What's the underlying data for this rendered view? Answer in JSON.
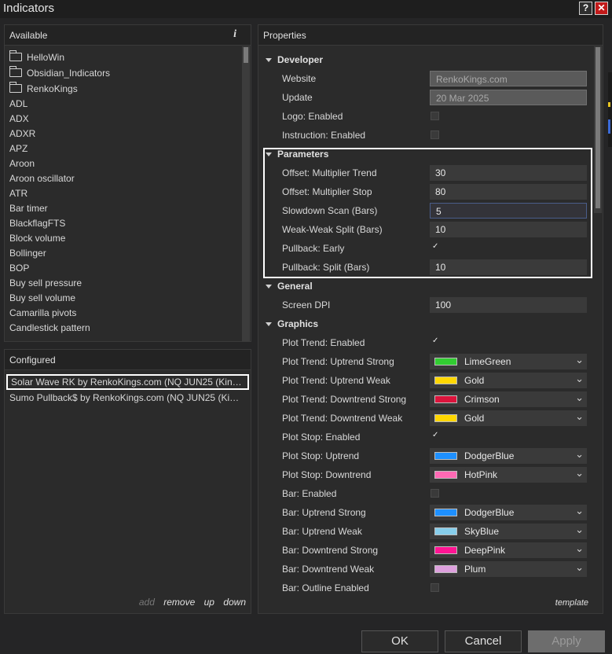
{
  "window": {
    "title": "Indicators",
    "help_label": "?",
    "close_label": "✕"
  },
  "available": {
    "header": "Available",
    "info_label": "i",
    "folders": [
      "HelloWin",
      "Obsidian_Indicators",
      "RenkoKings"
    ],
    "items": [
      "ADL",
      "ADX",
      "ADXR",
      "APZ",
      "Aroon",
      "Aroon oscillator",
      "ATR",
      "Bar timer",
      "BlackflagFTS",
      "Block volume",
      "Bollinger",
      "BOP",
      "Buy sell pressure",
      "Buy sell volume",
      "Camarilla pivots",
      "Candlestick pattern"
    ]
  },
  "configured": {
    "header": "Configured",
    "items": [
      "Solar Wave RK by RenkoKings.com (NQ JUN25 (Kin…",
      "Sumo Pullback$ by RenkoKings.com (NQ JUN25 (Ki…"
    ],
    "actions": {
      "add": "add",
      "remove": "remove",
      "up": "up",
      "down": "down"
    }
  },
  "properties": {
    "header": "Properties",
    "template_label": "template",
    "developer": {
      "title": "Developer",
      "website_label": "Website",
      "website_value": "RenkoKings.com",
      "update_label": "Update",
      "update_value": "20 Mar 2025",
      "logo_label": "Logo: Enabled",
      "instruction_label": "Instruction: Enabled"
    },
    "parameters": {
      "title": "Parameters",
      "rows": [
        {
          "label": "Offset: Multiplier Trend",
          "value": "30"
        },
        {
          "label": "Offset: Multiplier Stop",
          "value": "80"
        },
        {
          "label": "Slowdown Scan (Bars)",
          "value": "5"
        },
        {
          "label": "Weak-Weak Split (Bars)",
          "value": "10"
        },
        {
          "label": "Pullback: Early",
          "value": ""
        },
        {
          "label": "Pullback: Split (Bars)",
          "value": "10"
        }
      ]
    },
    "general": {
      "title": "General",
      "dpi_label": "Screen DPI",
      "dpi_value": "100"
    },
    "graphics": {
      "title": "Graphics",
      "rows": [
        {
          "label": "Plot Trend: Enabled",
          "type": "check",
          "checked": true
        },
        {
          "label": "Plot Trend: Uptrend Strong",
          "type": "color",
          "value": "LimeGreen",
          "color": "#32cd32"
        },
        {
          "label": "Plot Trend: Uptrend Weak",
          "type": "color",
          "value": "Gold",
          "color": "#ffd700"
        },
        {
          "label": "Plot Trend: Downtrend Strong",
          "type": "color",
          "value": "Crimson",
          "color": "#dc143c"
        },
        {
          "label": "Plot Trend: Downtrend Weak",
          "type": "color",
          "value": "Gold",
          "color": "#ffd700"
        },
        {
          "label": "Plot Stop: Enabled",
          "type": "check",
          "checked": true
        },
        {
          "label": "Plot Stop: Uptrend",
          "type": "color",
          "value": "DodgerBlue",
          "color": "#1e90ff"
        },
        {
          "label": "Plot Stop: Downtrend",
          "type": "color",
          "value": "HotPink",
          "color": "#ff69b4"
        },
        {
          "label": "Bar: Enabled",
          "type": "check",
          "checked": false
        },
        {
          "label": "Bar: Uptrend Strong",
          "type": "color",
          "value": "DodgerBlue",
          "color": "#1e90ff"
        },
        {
          "label": "Bar: Uptrend Weak",
          "type": "color",
          "value": "SkyBlue",
          "color": "#87ceeb"
        },
        {
          "label": "Bar: Downtrend Strong",
          "type": "color",
          "value": "DeepPink",
          "color": "#ff1493"
        },
        {
          "label": "Bar: Downtrend Weak",
          "type": "color",
          "value": "Plum",
          "color": "#dda0dd"
        },
        {
          "label": "Bar: Outline Enabled",
          "type": "check",
          "checked": false
        }
      ]
    }
  },
  "buttons": {
    "ok": "OK",
    "cancel": "Cancel",
    "apply": "Apply"
  }
}
